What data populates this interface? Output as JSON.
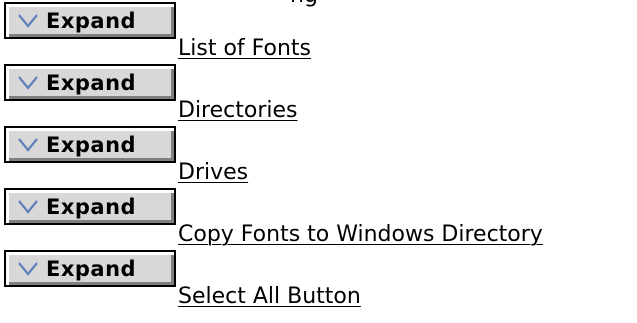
{
  "page": {
    "cut_heading": "ng"
  },
  "items": [
    {
      "button_label": "Expand",
      "link_text": "List of Fonts"
    },
    {
      "button_label": "Expand",
      "link_text": "Directories"
    },
    {
      "button_label": "Expand",
      "link_text": "Drives"
    },
    {
      "button_label": "Expand",
      "link_text": "Copy Fonts to Windows Directory"
    },
    {
      "button_label": "Expand",
      "link_text": "Select All Button"
    }
  ],
  "icons": {
    "expand": "chevron-down-icon"
  },
  "colors": {
    "background": "#ffffff",
    "button_face": "#d8d8d8",
    "button_shadow": "#7f7f7f",
    "chevron": "#5f7fb8"
  }
}
